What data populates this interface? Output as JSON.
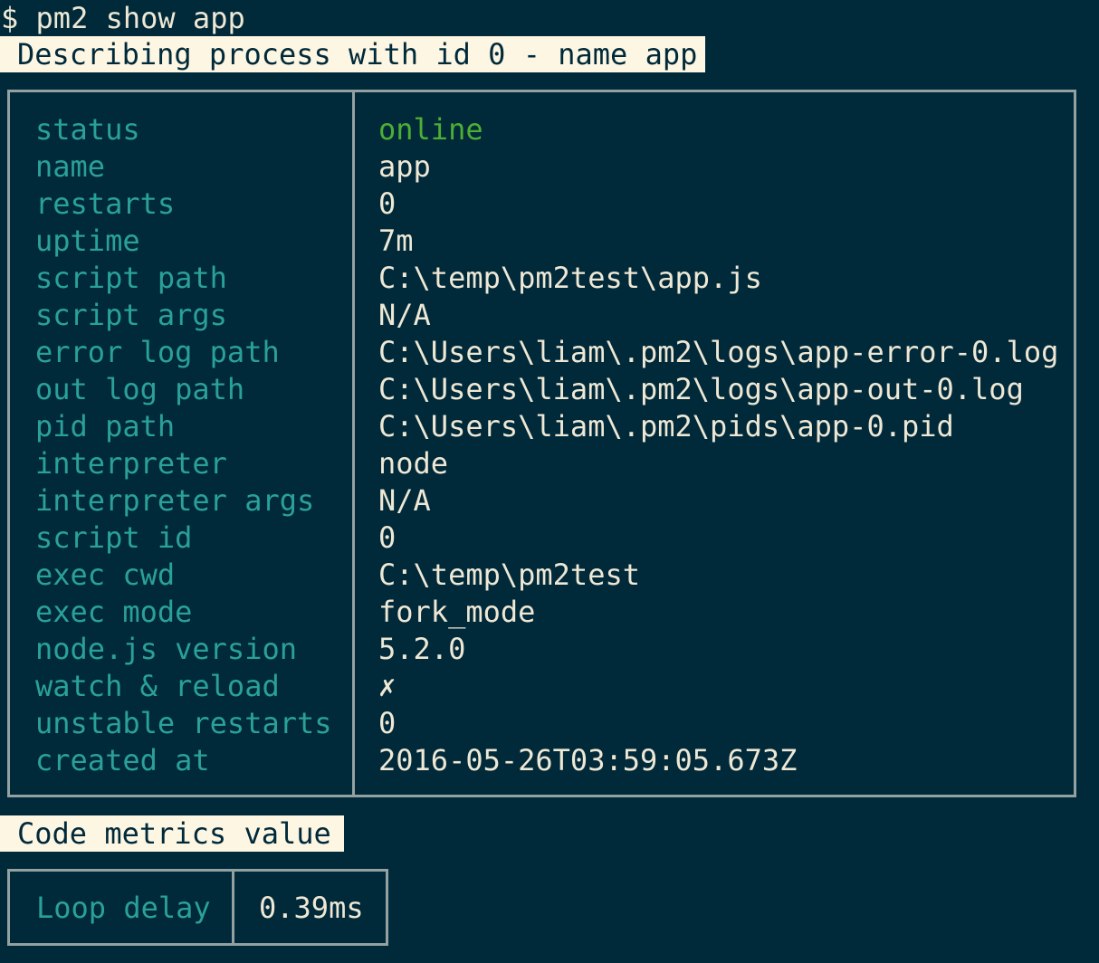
{
  "command": "$ pm2 show app",
  "describe_banner": "Describing process with id 0 - name app",
  "details": [
    {
      "key": "status",
      "value": "online"
    },
    {
      "key": "name",
      "value": "app"
    },
    {
      "key": "restarts",
      "value": "0"
    },
    {
      "key": "uptime",
      "value": "7m"
    },
    {
      "key": "script path",
      "value": "C:\\temp\\pm2test\\app.js"
    },
    {
      "key": "script args",
      "value": "N/A"
    },
    {
      "key": "error log path",
      "value": "C:\\Users\\liam\\.pm2\\logs\\app-error-0.log"
    },
    {
      "key": "out log path",
      "value": "C:\\Users\\liam\\.pm2\\logs\\app-out-0.log"
    },
    {
      "key": "pid path",
      "value": "C:\\Users\\liam\\.pm2\\pids\\app-0.pid"
    },
    {
      "key": "interpreter",
      "value": "node"
    },
    {
      "key": "interpreter args",
      "value": "N/A"
    },
    {
      "key": "script id",
      "value": "0"
    },
    {
      "key": "exec cwd",
      "value": "C:\\temp\\pm2test"
    },
    {
      "key": "exec mode",
      "value": "fork_mode"
    },
    {
      "key": "node.js version",
      "value": "5.2.0"
    },
    {
      "key": "watch & reload",
      "value": "✗"
    },
    {
      "key": "unstable restarts",
      "value": "0"
    },
    {
      "key": "created at",
      "value": "2016-05-26T03:59:05.673Z"
    }
  ],
  "metrics_banner": "Code metrics value",
  "metrics": [
    {
      "key": "Loop delay",
      "value": "0.39ms"
    }
  ],
  "colors": {
    "background": "#00293a",
    "key_text": "#2aa198",
    "value_text": "#eee8d5",
    "online": "#4caf34",
    "banner_bg": "#fdf6e3",
    "border": "#93a1a1"
  }
}
